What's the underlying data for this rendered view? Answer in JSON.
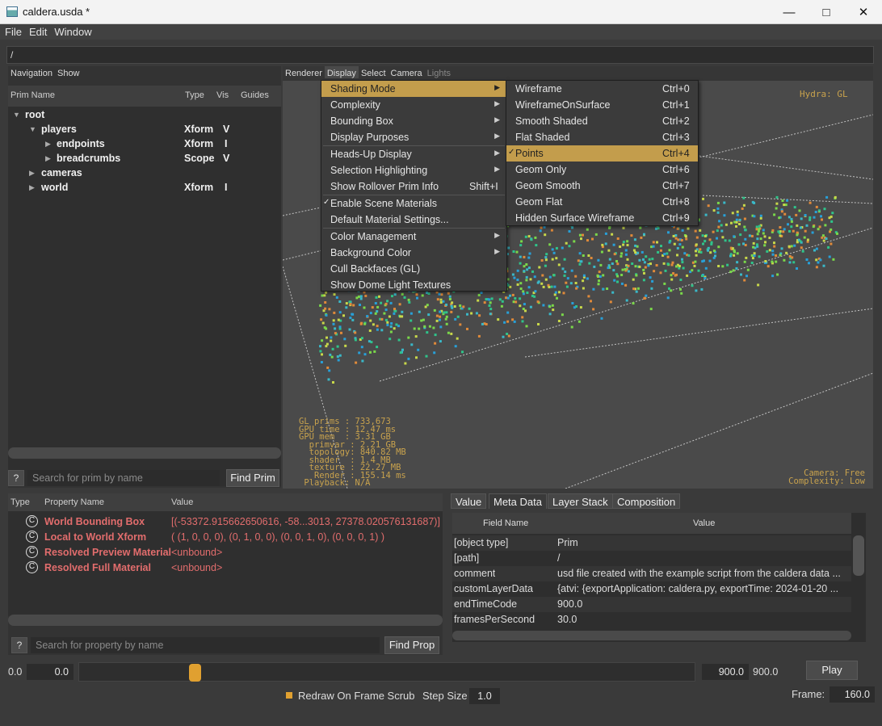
{
  "window": {
    "title": "caldera.usda *",
    "minimize": "—",
    "maximize": "□",
    "close": "✕"
  },
  "menubar": [
    "File",
    "Edit",
    "Window"
  ],
  "path": "/",
  "prim_panel": {
    "tabs": [
      "Navigation",
      "Show"
    ],
    "columns": [
      "Prim Name",
      "Type",
      "Vis",
      "Guides"
    ],
    "rows": [
      {
        "name": "root",
        "type": "",
        "vis": "",
        "expanded": true
      },
      {
        "name": "players",
        "type": "Xform",
        "vis": "V",
        "expanded": true
      },
      {
        "name": "endpoints",
        "type": "Xform",
        "vis": "I",
        "expanded": false
      },
      {
        "name": "breadcrumbs",
        "type": "Scope",
        "vis": "V",
        "expanded": false
      },
      {
        "name": "cameras",
        "type": "",
        "vis": "",
        "expanded": false
      },
      {
        "name": "world",
        "type": "Xform",
        "vis": "I",
        "expanded": false
      }
    ],
    "help": "?",
    "search_placeholder": "Search for prim by name",
    "find_button": "Find Prim"
  },
  "viewport": {
    "tabs": [
      "Renderer",
      "Display",
      "Select",
      "Camera",
      "Lights"
    ],
    "hydra": "Hydra: GL",
    "hud_stats": [
      "GL prims : 733,673",
      "GPU time : 12.47 ms",
      "GPU mem  : 3.31 GB",
      "  primvar : 2.21 GB",
      "  topology: 840.82 MB",
      "  shader  : 1.4 MB",
      "  texture : 22.27 MB",
      "   Render : 155.14 ms",
      " Playback: N/A"
    ],
    "hud_right": [
      "Camera: Free",
      "Complexity: Low"
    ]
  },
  "display_menu": [
    {
      "label": "Shading Mode",
      "shortcut": "",
      "submenu": true,
      "highlight": true
    },
    {
      "label": "Complexity",
      "shortcut": "",
      "submenu": true
    },
    {
      "label": "Bounding Box",
      "shortcut": "",
      "submenu": true
    },
    {
      "label": "Display Purposes",
      "shortcut": "",
      "submenu": true
    },
    {
      "label": "Heads-Up Display",
      "shortcut": "",
      "submenu": true
    },
    {
      "label": "Selection Highlighting",
      "shortcut": "",
      "submenu": true
    },
    {
      "label": "Show Rollover Prim Info",
      "shortcut": "Shift+I",
      "submenu": false
    },
    {
      "label": "Enable Scene Materials",
      "shortcut": "",
      "submenu": false,
      "checked": true
    },
    {
      "label": "Default Material Settings...",
      "shortcut": "",
      "submenu": false
    },
    {
      "label": "Color Management",
      "shortcut": "",
      "submenu": true
    },
    {
      "label": "Background Color",
      "shortcut": "",
      "submenu": true
    },
    {
      "label": "Cull Backfaces (GL)",
      "shortcut": "",
      "submenu": false
    },
    {
      "label": "Show Dome Light Textures",
      "shortcut": "",
      "submenu": false
    }
  ],
  "shading_menu": [
    {
      "label": "Wireframe",
      "shortcut": "Ctrl+0"
    },
    {
      "label": "WireframeOnSurface",
      "shortcut": "Ctrl+1"
    },
    {
      "label": "Smooth Shaded",
      "shortcut": "Ctrl+2"
    },
    {
      "label": "Flat Shaded",
      "shortcut": "Ctrl+3"
    },
    {
      "label": "Points",
      "shortcut": "Ctrl+4",
      "checked": true
    },
    {
      "label": "Geom Only",
      "shortcut": "Ctrl+6"
    },
    {
      "label": "Geom Smooth",
      "shortcut": "Ctrl+7"
    },
    {
      "label": "Geom Flat",
      "shortcut": "Ctrl+8"
    },
    {
      "label": "Hidden Surface Wireframe",
      "shortcut": "Ctrl+9"
    }
  ],
  "property_panel": {
    "columns": [
      "Type",
      "Property Name",
      "Value"
    ],
    "rows": [
      {
        "icon": "C",
        "name": "World Bounding Box",
        "value": "[(-53372.915662650616, -58...3013, 27378.020576131687)]"
      },
      {
        "icon": "C",
        "name": "Local to World Xform",
        "value": "( (1, 0, 0, 0), (0, 1, 0, 0), (0, 0, 1, 0), (0, 0, 0, 1) )"
      },
      {
        "icon": "C",
        "name": "Resolved Preview Material",
        "value": "<unbound>"
      },
      {
        "icon": "C",
        "name": "Resolved Full Material",
        "value": "<unbound>"
      }
    ],
    "help": "?",
    "search_placeholder": "Search for property by name",
    "find_button": "Find Prop"
  },
  "meta_panel": {
    "tabs": [
      "Value",
      "Meta Data",
      "Layer Stack",
      "Composition"
    ],
    "active_tab": "Meta Data",
    "columns": [
      "Field Name",
      "Value"
    ],
    "rows": [
      {
        "field": "[object type]",
        "value": "Prim"
      },
      {
        "field": "[path]",
        "value": "/"
      },
      {
        "field": "comment",
        "value": "usd file created with the example script from the caldera data ..."
      },
      {
        "field": "customLayerData",
        "value": "{atvi: {exportApplication: caldera.py, exportTime: 2024-01-20 ..."
      },
      {
        "field": "endTimeCode",
        "value": "900.0"
      },
      {
        "field": "framesPerSecond",
        "value": "30.0"
      }
    ]
  },
  "timeline": {
    "start_label": "0.0",
    "start_value": "0.0",
    "end_value": "900.0",
    "end_label": "900.0",
    "play": "Play",
    "redraw_label": "Redraw On Frame Scrub",
    "step_label": "Step Size",
    "step_value": "1.0",
    "frame_label": "Frame:",
    "frame_value": "160.0",
    "slider_position": 0.178,
    "accent": "#e0a030"
  },
  "colors": {
    "highlight": "#c39d4c",
    "property_text": "#e26d6d",
    "hud": "#c8a24d"
  }
}
